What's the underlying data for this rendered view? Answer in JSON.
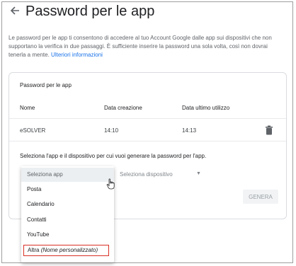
{
  "header": {
    "title": "Password per le app",
    "back_icon": "arrow-back-icon"
  },
  "intro": {
    "text": "Le password per le app ti consentono di accedere al tuo Account Google dalle app sui dispositivi che non supportano la verifica in due passaggi. È sufficiente inserire la password una sola volta, così non dovrai tenerla a mente.",
    "link": "Ulteriori informazioni"
  },
  "card": {
    "title": "Password per le app",
    "columns": [
      "Nome",
      "Data creazione",
      "Data ultimo utilizzo"
    ],
    "rows": [
      {
        "name": "eSOLVER",
        "created": "14:10",
        "last_used": "14:13",
        "action_icon": "trash-icon"
      }
    ],
    "prompt": "Seleziona l'app e il dispositivo per cui vuoi generare la password per l'app.",
    "device_placeholder": "Seleziona dispositivo",
    "generate_label": "GENERA"
  },
  "dropdown": {
    "selected": "Seleziona app",
    "options": [
      "Posta",
      "Calendario",
      "Contatti",
      "YouTube"
    ],
    "custom": {
      "label": "Altra",
      "note": "(Nome personalizzato)"
    }
  },
  "colors": {
    "link": "#1a73e8",
    "highlight_border": "#d93025",
    "disabled_button": "#f1f3f4"
  }
}
